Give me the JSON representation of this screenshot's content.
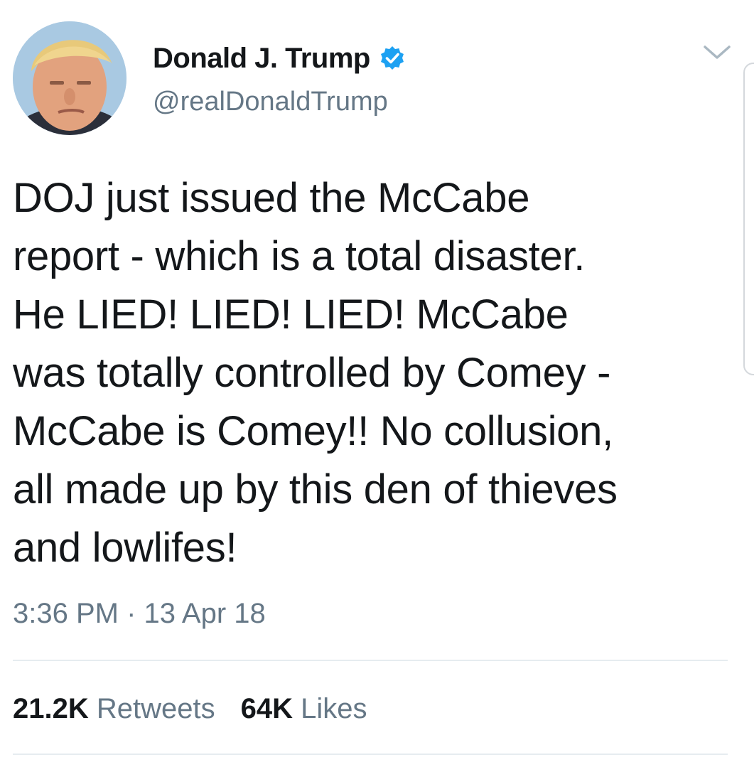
{
  "author": {
    "display_name": "Donald J. Trump",
    "handle": "@realDonaldTrump",
    "verified_icon": "verified-badge-icon",
    "verified_color": "#1da1f2"
  },
  "tweet": {
    "text": "DOJ just issued the McCabe\nreport - which is a total disaster.\nHe LIED! LIED! LIED! McCabe\nwas totally controlled by Comey -\nMcCabe is Comey!! No collusion,\nall made up by this den of thieves\nand lowlifes!",
    "timestamp": "3:36 PM · 13 Apr 18"
  },
  "stats": {
    "retweets_count": "21.2K",
    "retweets_label": "Retweets",
    "likes_count": "64K",
    "likes_label": "Likes"
  },
  "menu": {
    "caret_icon": "chevron-down-icon"
  },
  "colors": {
    "text_primary": "#14171a",
    "text_secondary": "#657786",
    "divider": "#e6ecf0"
  }
}
